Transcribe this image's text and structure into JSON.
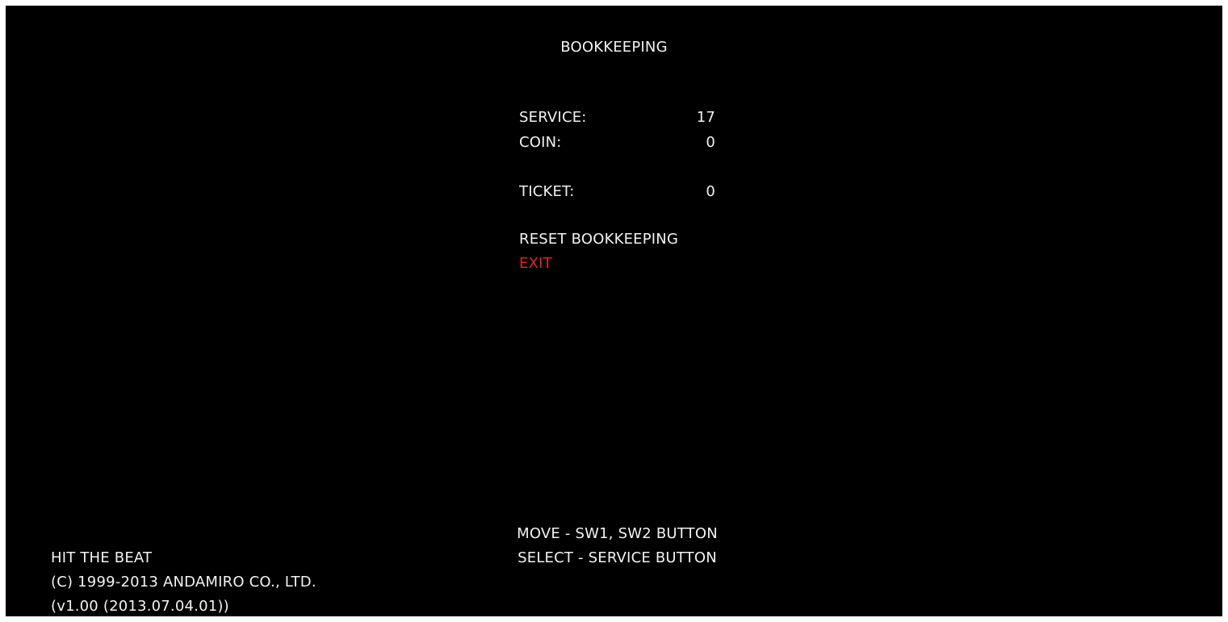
{
  "title": "BOOKKEEPING",
  "stats": [
    {
      "label": "SERVICE:",
      "value": "17"
    },
    {
      "label": "COIN:",
      "value": "0"
    },
    {
      "label": "TICKET:",
      "value": "0"
    }
  ],
  "menu": {
    "items": [
      {
        "label": "RESET BOOKKEEPING",
        "selected": false
      },
      {
        "label": "EXIT",
        "selected": true
      }
    ],
    "selected_color": "#e0261f"
  },
  "help": {
    "move": "MOVE - SW1, SW2 BUTTON",
    "select": "SELECT - SERVICE BUTTON"
  },
  "footer": {
    "game_name": "HIT THE BEAT",
    "copyright": "(C) 1999-2013 ANDAMIRO CO., LTD.",
    "version": "(v1.00 (2013.07.04.01))"
  },
  "colors": {
    "background": "#000000",
    "text": "#f2f2f2",
    "highlight": "#e0261f"
  }
}
